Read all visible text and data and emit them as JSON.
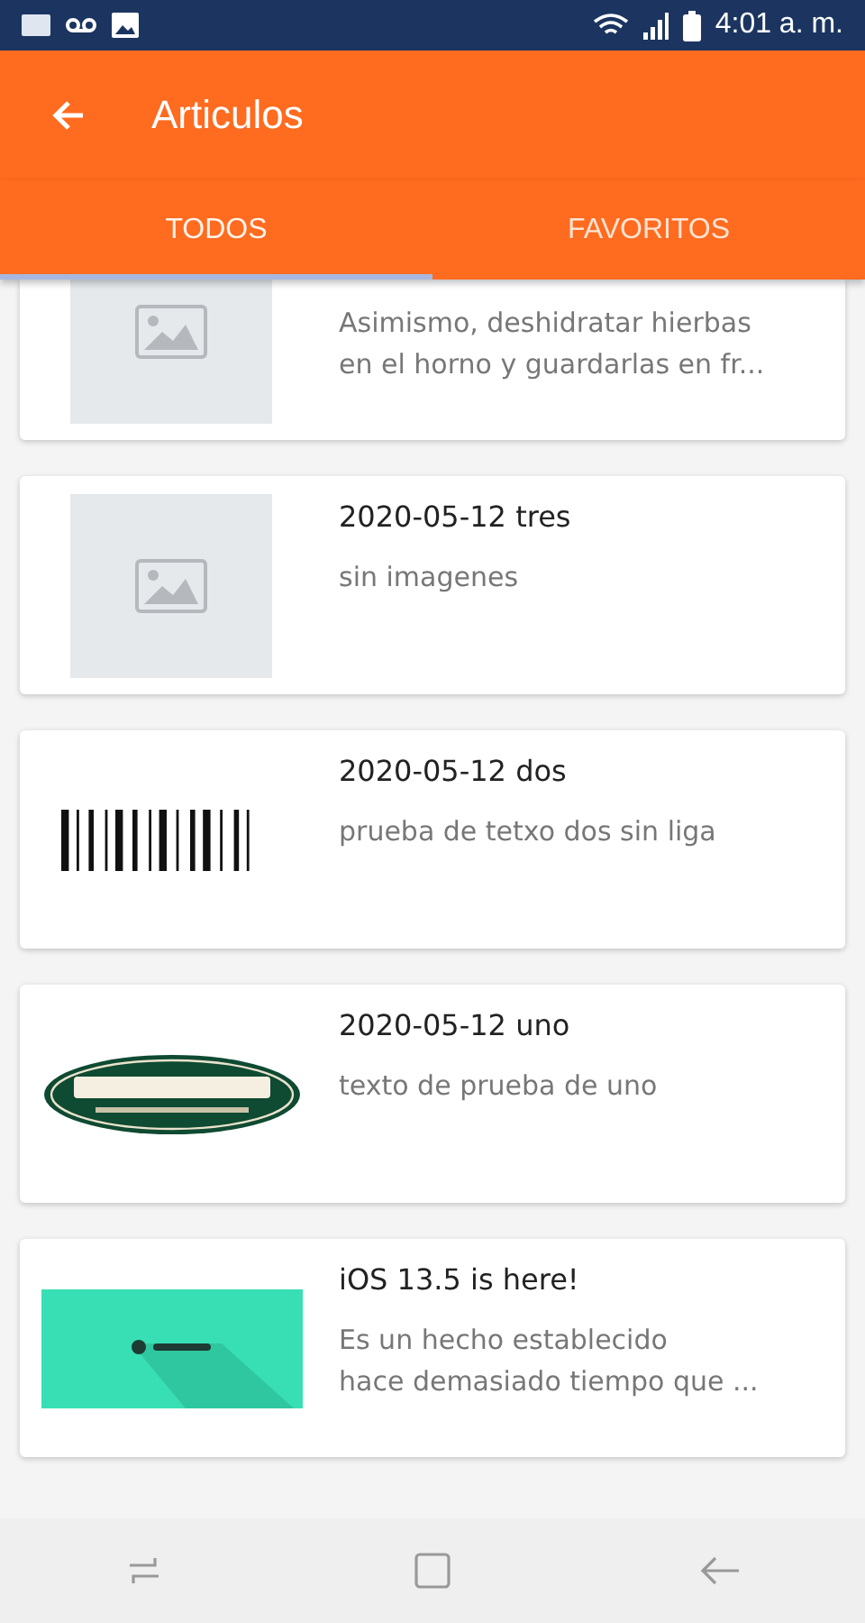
{
  "status_bar": {
    "time": "4:01 a. m."
  },
  "app_bar": {
    "title": "Articulos"
  },
  "tabs": [
    {
      "label": "TODOS",
      "selected": true
    },
    {
      "label": "FAVORITOS",
      "selected": false
    }
  ],
  "articles": [
    {
      "partial": true,
      "thumbnail": {
        "kind": "placeholder"
      },
      "lines": [
        "Asimismo, deshidratar hierbas",
        "en el horno y guardarlas en fr..."
      ]
    },
    {
      "partial": false,
      "thumbnail": {
        "kind": "placeholder"
      },
      "title": "2020-05-12 tres",
      "lines": [
        "sin imagenes"
      ]
    },
    {
      "partial": false,
      "thumbnail": {
        "kind": "barcode"
      },
      "title": "2020-05-12 dos",
      "lines": [
        "prueba de tetxo dos sin liga"
      ]
    },
    {
      "partial": false,
      "thumbnail": {
        "kind": "oval"
      },
      "title": "2020-05-12 uno",
      "lines": [
        "texto de prueba de uno"
      ]
    },
    {
      "partial": false,
      "thumbnail": {
        "kind": "banner"
      },
      "title": "iOS 13.5 is here!",
      "lines": [
        "Es un hecho establecido",
        "hace demasiado tiempo que ..."
      ]
    }
  ]
}
